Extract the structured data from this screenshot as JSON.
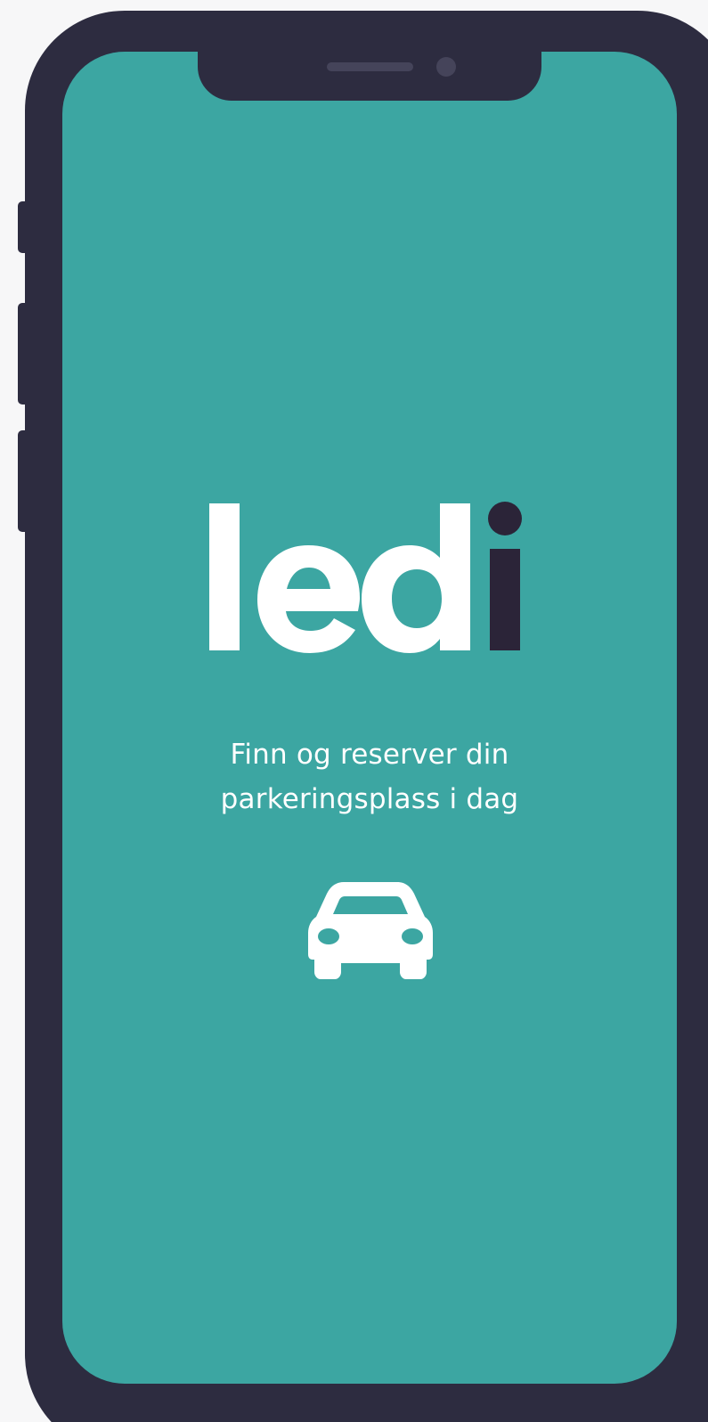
{
  "app": {
    "logo_text": "ledi"
  },
  "splash": {
    "tagline_line1": "Finn og reserver din",
    "tagline_line2": "parkeringsplass i dag",
    "icon": "car-icon"
  },
  "colors": {
    "background": "#3ca6a2",
    "phone_frame": "#2d2c40",
    "logo_primary": "#ffffff",
    "logo_accent": "#2b2438"
  }
}
